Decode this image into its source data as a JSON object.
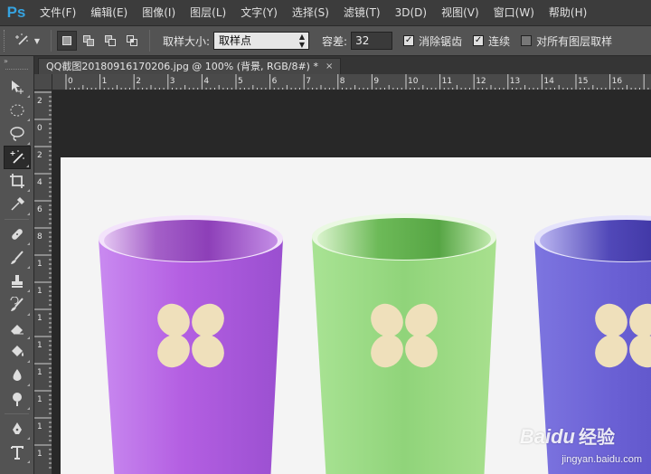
{
  "app": {
    "logo": "Ps"
  },
  "menu": [
    "文件(F)",
    "编辑(E)",
    "图像(I)",
    "图层(L)",
    "文字(Y)",
    "选择(S)",
    "滤镜(T)",
    "3D(D)",
    "视图(V)",
    "窗口(W)",
    "帮助(H)"
  ],
  "options": {
    "tool_icon": "magic-wand-icon",
    "sample_size_label": "取样大小:",
    "sample_size_value": "取样点",
    "tolerance_label": "容差:",
    "tolerance_value": "32",
    "anti_alias_label": "消除锯齿",
    "anti_alias_checked": true,
    "contiguous_label": "连续",
    "contiguous_checked": true,
    "all_layers_label": "对所有图层取样",
    "all_layers_checked": false
  },
  "document": {
    "tab_title": "QQ截图20180916170206.jpg @ 100% (背景, RGB/8#) *",
    "close_symbol": "×"
  },
  "rulers": {
    "horizontal": [
      "0",
      "1",
      "2",
      "3",
      "4",
      "5",
      "6",
      "7",
      "8",
      "9",
      "10",
      "11",
      "12",
      "13",
      "14",
      "15",
      "16"
    ],
    "vertical": [
      "2",
      "0",
      "2",
      "4",
      "6",
      "8",
      "1",
      "1",
      "1",
      "1",
      "1",
      "1",
      "1",
      "1"
    ]
  },
  "tools": [
    "move-icon",
    "marquee-icon",
    "lasso-icon",
    "magic-wand-icon",
    "crop-icon",
    "eyedropper-icon",
    "healing-brush-icon",
    "brush-icon",
    "clone-stamp-icon",
    "history-brush-icon",
    "eraser-icon",
    "paint-bucket-icon",
    "blur-icon",
    "dodge-icon",
    "pen-icon",
    "type-icon"
  ],
  "image": {
    "cup_colors": [
      "#b35ee0",
      "#8fd67a",
      "#6a62d6"
    ],
    "flower_color": "#efe0bb"
  },
  "watermark": {
    "brand": "Baidu",
    "brand_cn": "经验",
    "url": "jingyan.baidu.com"
  }
}
